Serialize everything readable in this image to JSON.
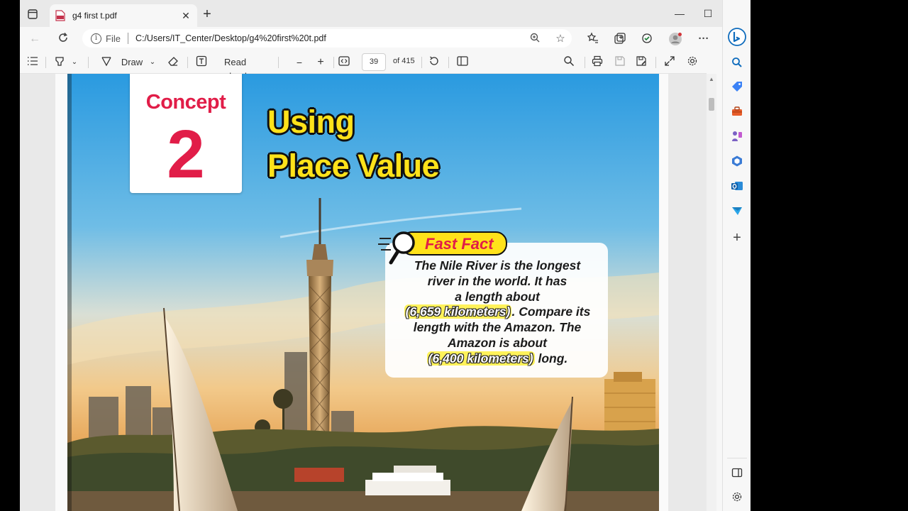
{
  "browser": {
    "tab": {
      "title": "g4 first t.pdf"
    },
    "address": {
      "file_label": "File",
      "url": "C:/Users/IT_Center/Desktop/g4%20first%20t.pdf"
    }
  },
  "pdf_toolbar": {
    "draw_label": "Draw",
    "read_aloud_label": "Read aloud",
    "page_number": "39",
    "page_total": "of 415"
  },
  "page_content": {
    "concept_word": "Concept",
    "concept_number": "2",
    "title_line1": "Using",
    "title_line2": "Place Value",
    "fast_fact_label": "Fast Fact",
    "fact_line1": "The Nile River is the longest",
    "fact_line2": "river in the world. It has",
    "fact_line3": "a length about",
    "fact_highlight1": "(6,659 kilometers)",
    "fact_line4_rest": ". Compare its",
    "fact_line5": "length with the Amazon. The",
    "fact_line6": "Amazon is about",
    "fact_highlight2": "(6,400 kilometers)",
    "fact_line7_rest": " long."
  },
  "colors": {
    "concept_red": "#e11d48",
    "title_yellow": "#ffe21a",
    "edge_blue": "#0f6cbd"
  },
  "icons": [
    "tab-actions-icon",
    "pdf-file-icon",
    "close-icon",
    "plus-icon",
    "minimize-icon",
    "maximize-icon",
    "back-icon",
    "refresh-icon",
    "info-icon",
    "zoom-icon",
    "star-icon",
    "favorites-icon",
    "collections-icon",
    "extensions-icon",
    "profile-icon",
    "more-icon",
    "bing-icon",
    "contents-icon",
    "highlight-icon",
    "draw-icon",
    "eraser-icon",
    "text-icon",
    "minus-icon",
    "fit-page-icon",
    "rotate-icon",
    "page-view-icon",
    "search-icon",
    "print-icon",
    "save-icon",
    "save-as-icon",
    "fullscreen-icon",
    "settings-icon",
    "tag-icon",
    "toolbox-icon",
    "games-icon",
    "office-icon",
    "outlook-icon",
    "send-icon",
    "split-icon"
  ]
}
